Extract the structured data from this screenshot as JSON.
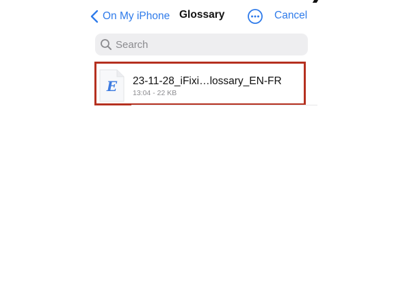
{
  "nav": {
    "back_label": "On My iPhone",
    "title": "Glossary",
    "more_icon": "ellipsis-circle-icon",
    "cancel_label": "Cancel",
    "accent_color": "#2f7bea"
  },
  "search": {
    "placeholder": "Search",
    "value": ""
  },
  "files": [
    {
      "name": "23-11-28_iFixi…lossary_EN-FR",
      "meta": "13:04 - 22 KB",
      "icon": "document-e-icon",
      "highlight_color": "#b5301f"
    }
  ]
}
